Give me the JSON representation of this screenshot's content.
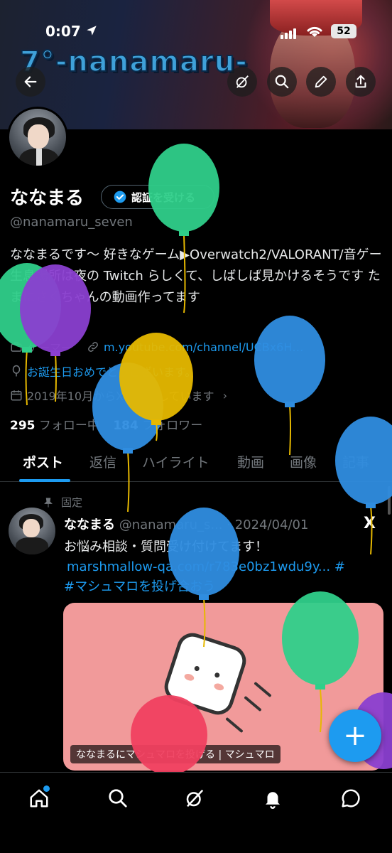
{
  "status_bar": {
    "time": "0:07",
    "battery": "52"
  },
  "banner": {
    "title": "7°-nanamaru-"
  },
  "profile": {
    "name": "ななまる",
    "verify_label": "認証を受ける",
    "handle": "@nanamaru_seven",
    "bio": "ななまるです〜 好きなゲーム▶Overwatch2/VALORANT/音ゲー 生息場所は夜の Twitch らしくて、しばしば見かけるそうです たまにさくちゃんの動画作ってます",
    "category": "ゲーマー",
    "link": "m.youtube.com/channel/UCBx6H…",
    "birthday": "お誕生日おめでとうございます。",
    "joined": "2019年10月からXを利用しています",
    "following_count": "295",
    "following_label": "フォロー中",
    "followers_count": "184",
    "followers_label": "フォロワー"
  },
  "tabs": [
    {
      "label": "ポスト"
    },
    {
      "label": "返信"
    },
    {
      "label": "ハイライト"
    },
    {
      "label": "動画"
    },
    {
      "label": "画像"
    },
    {
      "label": "記事"
    }
  ],
  "post": {
    "pinned_label": "固定",
    "author": "ななまる",
    "handle_date": "@nanamaru_s... · 2024/04/01",
    "text": "お悩み相談・質問受け付けてます！",
    "link": "marshmallow-qa.com/r783e0bz1wdu9y...",
    "hashtag": "#マシュマロを投げ合おう",
    "card_caption": "ななまるにマシュマロを投げる | マシュマロ"
  },
  "colors": {
    "accent": "#1d9bf0",
    "balloon_green": "#2fcf8a",
    "balloon_purple": "#8a3fd0",
    "balloon_blue": "#2f8de0",
    "balloon_yellow": "#e6b800",
    "balloon_red": "#f04060"
  },
  "icons": {
    "back": "arrow-left-icon",
    "grok": "grok-icon",
    "search": "search-icon",
    "edit": "pencil-icon",
    "share": "share-icon",
    "home": "home-icon",
    "notifications": "bell-icon",
    "messages": "message-icon"
  }
}
